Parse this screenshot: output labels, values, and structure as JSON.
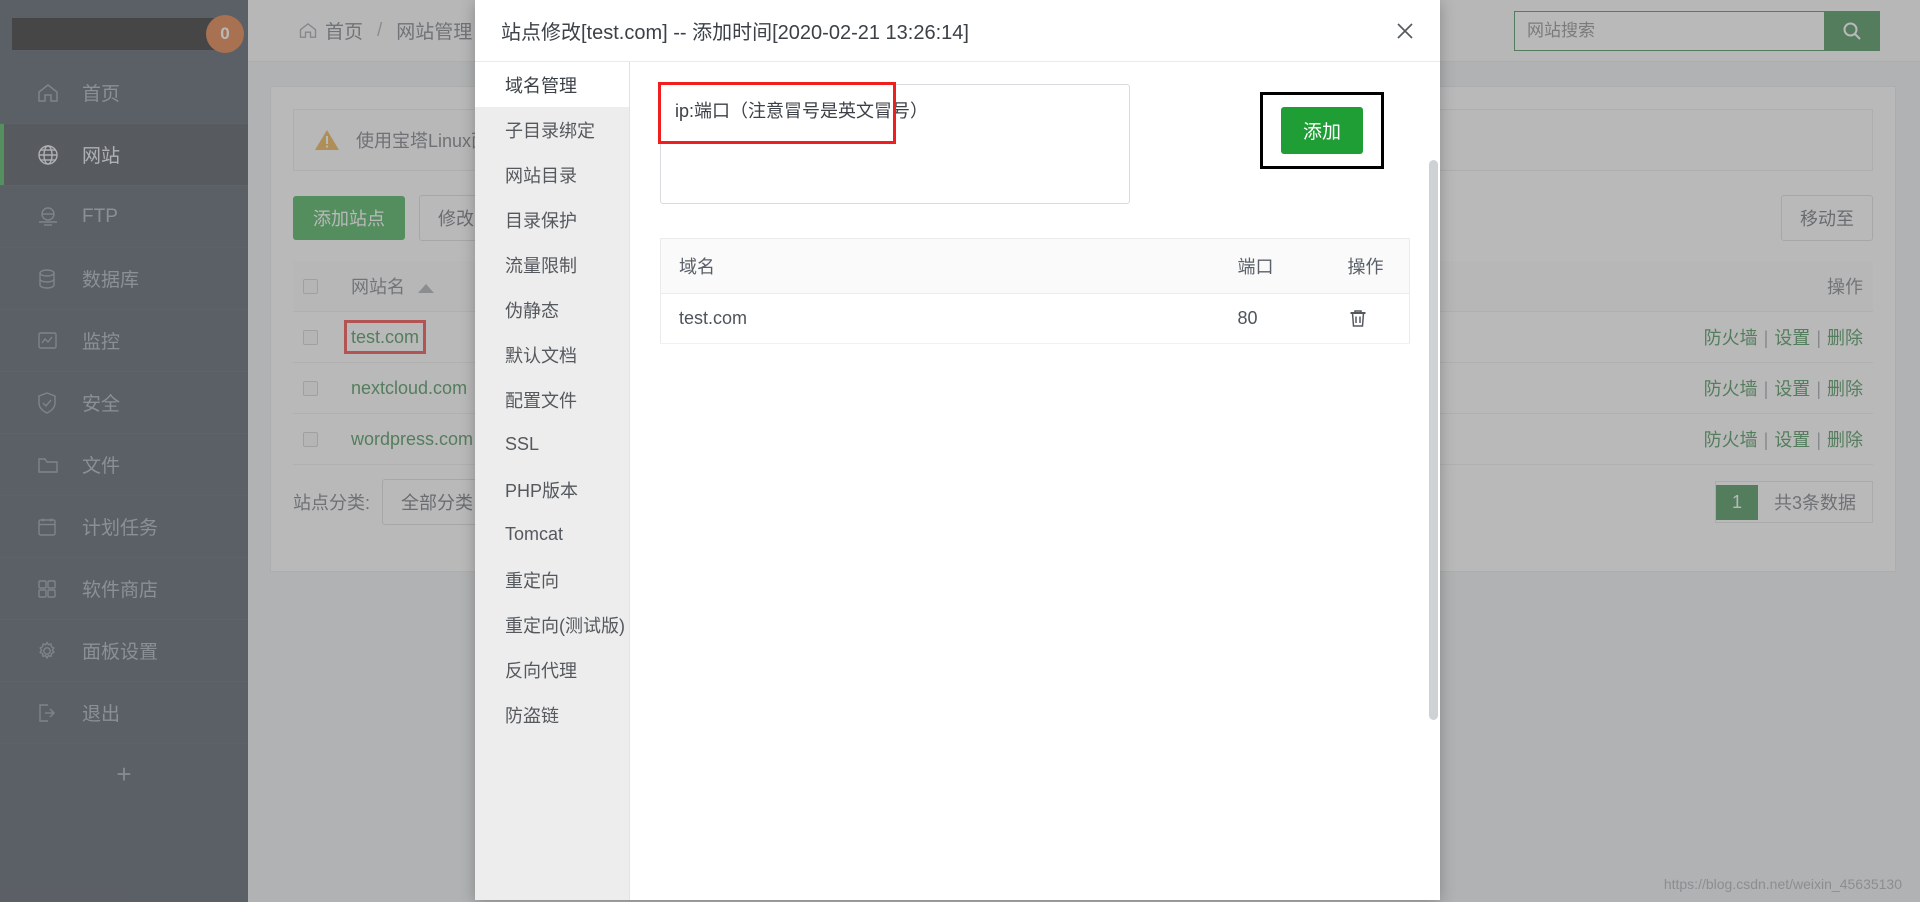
{
  "sidebar": {
    "badge": "0",
    "items": [
      {
        "label": "首页",
        "icon": "home-icon",
        "active": false
      },
      {
        "label": "网站",
        "icon": "globe-icon",
        "active": true
      },
      {
        "label": "FTP",
        "icon": "ftp-icon",
        "active": false
      },
      {
        "label": "数据库",
        "icon": "database-icon",
        "active": false
      },
      {
        "label": "监控",
        "icon": "monitor-icon",
        "active": false
      },
      {
        "label": "安全",
        "icon": "shield-icon",
        "active": false
      },
      {
        "label": "文件",
        "icon": "folder-icon",
        "active": false
      },
      {
        "label": "计划任务",
        "icon": "calendar-icon",
        "active": false
      },
      {
        "label": "软件商店",
        "icon": "grid-icon",
        "active": false
      },
      {
        "label": "面板设置",
        "icon": "gear-icon",
        "active": false
      },
      {
        "label": "退出",
        "icon": "logout-icon",
        "active": false
      }
    ],
    "add_label": "+"
  },
  "breadcrumb": {
    "home": "首页",
    "separator": "/",
    "current": "网站管理"
  },
  "search": {
    "placeholder": "网站搜索",
    "value": "",
    "button_icon": "search-icon"
  },
  "alert": {
    "icon": "warning-icon",
    "text": "使用宝塔Linux面板"
  },
  "toolbar": {
    "add_site": "添加站点",
    "modify_default": "修改默认页",
    "move_to": "移动至"
  },
  "sites_table": {
    "columns": [
      "",
      "网站名",
      "操作"
    ],
    "sort_indicator": "ascending",
    "rows": [
      {
        "name": "test.com",
        "actions": [
          "防火墙",
          "设置",
          "删除"
        ],
        "highlighted": true
      },
      {
        "name": "nextcloud.com",
        "actions": [
          "防火墙",
          "设置",
          "删除"
        ],
        "highlighted": false
      },
      {
        "name": "wordpress.com",
        "actions": [
          "防火墙",
          "设置",
          "删除"
        ],
        "highlighted": false
      }
    ]
  },
  "footer": {
    "category_label": "站点分类:",
    "category_value": "全部分类",
    "page_current": "1",
    "total_text": "共3条数据"
  },
  "modal": {
    "title": "站点修改[test.com] -- 添加时间[2020-02-21 13:26:14]",
    "close_icon": "close-icon",
    "nav": [
      {
        "label": "域名管理",
        "active": true
      },
      {
        "label": "子目录绑定",
        "active": false
      },
      {
        "label": "网站目录",
        "active": false
      },
      {
        "label": "目录保护",
        "active": false
      },
      {
        "label": "流量限制",
        "active": false
      },
      {
        "label": "伪静态",
        "active": false
      },
      {
        "label": "默认文档",
        "active": false
      },
      {
        "label": "配置文件",
        "active": false
      },
      {
        "label": "SSL",
        "active": false
      },
      {
        "label": "PHP版本",
        "active": false
      },
      {
        "label": "Tomcat",
        "active": false
      },
      {
        "label": "重定向",
        "active": false
      },
      {
        "label": "重定向(测试版)",
        "active": false
      },
      {
        "label": "反向代理",
        "active": false
      },
      {
        "label": "防盗链",
        "active": false
      }
    ],
    "textarea": {
      "placeholder": "ip:端口（注意冒号是英文冒号）",
      "value": ""
    },
    "add_button": "添加",
    "domains_table": {
      "columns": [
        "域名",
        "端口",
        "操作"
      ],
      "rows": [
        {
          "domain": "test.com",
          "port": "80",
          "action_icon": "trash-icon"
        }
      ]
    }
  },
  "watermark": "https://blog.csdn.net/weixin_45635130",
  "colors": {
    "accent_green": "#1f9e36",
    "badge_orange": "#d9601c",
    "highlight_red": "#f01f1f",
    "sidebar_bg": "#303a47"
  }
}
